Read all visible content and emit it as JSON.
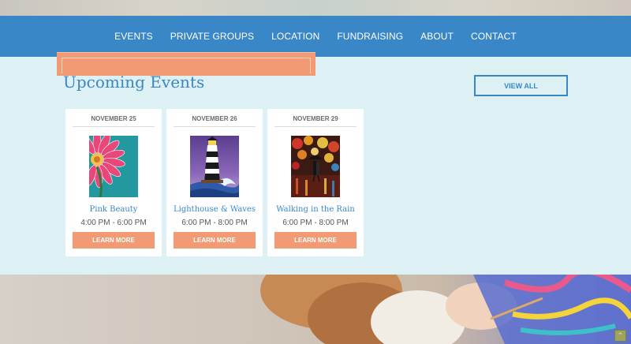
{
  "nav": {
    "items": [
      {
        "label": "EVENTS"
      },
      {
        "label": "PRIVATE GROUPS"
      },
      {
        "label": "LOCATION"
      },
      {
        "label": "FUNDRAISING"
      },
      {
        "label": "ABOUT"
      },
      {
        "label": "CONTACT"
      }
    ]
  },
  "events": {
    "title": "Upcoming Events",
    "view_all_label": "VIEW ALL",
    "cards": [
      {
        "date": "NOVEMBER 25",
        "title": "Pink Beauty",
        "time": "4:00 PM - 6:00 PM",
        "button": "LEARN MORE",
        "image": "pink-flower-painting"
      },
      {
        "date": "NOVEMBER 26",
        "title": "Lighthouse & Waves",
        "time": "6:00 PM - 8:00 PM",
        "button": "LEARN MORE",
        "image": "lighthouse-painting"
      },
      {
        "date": "NOVEMBER 29",
        "title": "Walking in the Rain",
        "time": "6:00 PM - 8:00 PM",
        "button": "LEARN MORE",
        "image": "rain-walk-painting"
      }
    ]
  },
  "scroll_top": {
    "icon": "arrow-up-icon",
    "glyph": "⌃"
  },
  "colors": {
    "nav": "#3a87c7",
    "accent": "#f19a73",
    "section_bg": "#ddf0f4"
  }
}
